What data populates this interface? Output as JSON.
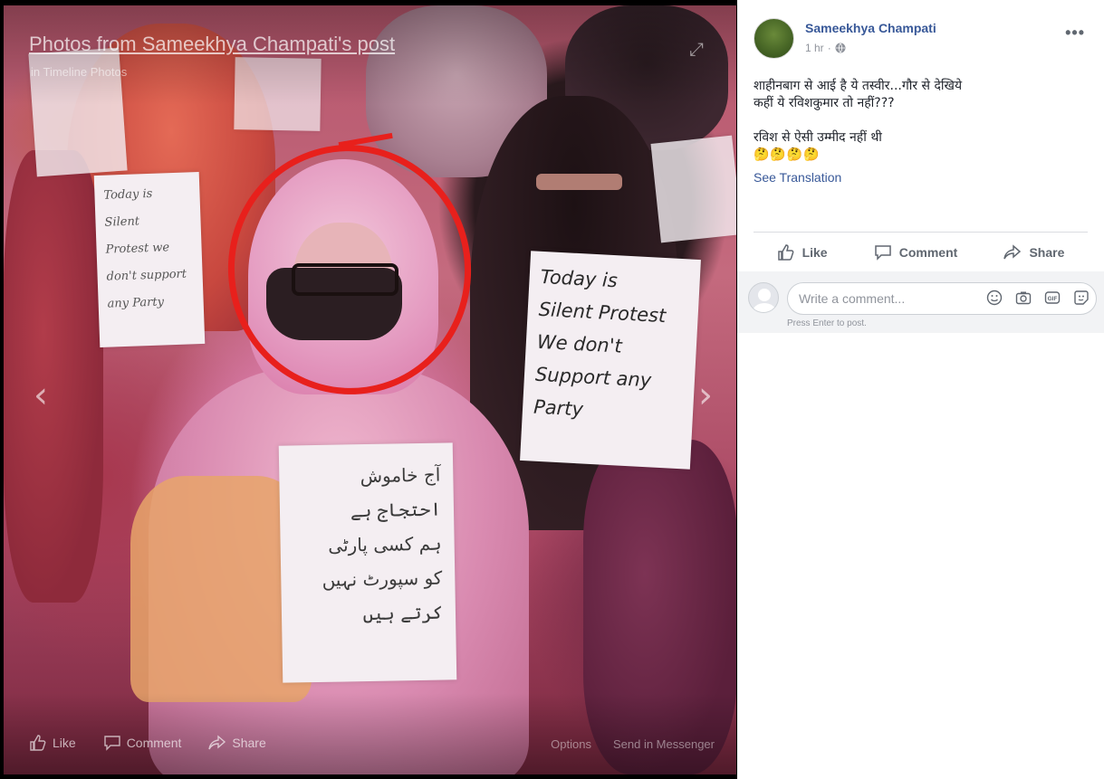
{
  "photo": {
    "album_title": "Photos from Sameekhya Champati's post",
    "album_subtitle": "in Timeline Photos",
    "actions": {
      "like": "Like",
      "comment": "Comment",
      "share": "Share",
      "options": "Options",
      "send": "Send in Messenger"
    },
    "signs": {
      "center_lines": [
        "آج خاموش",
        "احتجاج ہے",
        "ہم کسی پارٹی",
        "کو سپورٹ نہیں",
        "کرتے ہیں"
      ],
      "right_lines": [
        "Today is",
        "Silent Protest",
        "We don't",
        "Support any",
        "Party"
      ],
      "left_lines": [
        "Today is",
        "Silent",
        "Protest we",
        "don't support",
        "any Party"
      ]
    }
  },
  "post": {
    "author": "Sameekhya Champati",
    "time": "1 hr",
    "more": "•••",
    "text_line1": "शाहीनबाग से आई है ये तस्वीर...गौर से देखिये",
    "text_line2": "कहीं ये रविशकुमार तो नहीं???",
    "text_line3": "रविश से ऐसी उम्मीद नहीं थी",
    "emojis": "🤔🤔🤔🤔",
    "see_translation": "See Translation",
    "actions": {
      "like": "Like",
      "comment": "Comment",
      "share": "Share"
    },
    "comment_placeholder": "Write a comment...",
    "enter_hint": "Press Enter to post."
  },
  "colors": {
    "link": "#385898",
    "circle": "#e8201c",
    "text": "#1d2129",
    "muted": "#606770"
  },
  "icons": [
    "expand-icon",
    "chevron-left-icon",
    "chevron-right-icon",
    "thumbs-up-icon",
    "comment-icon",
    "share-icon",
    "globe-icon",
    "emoji-icon",
    "camera-icon",
    "gif-icon",
    "sticker-icon"
  ]
}
